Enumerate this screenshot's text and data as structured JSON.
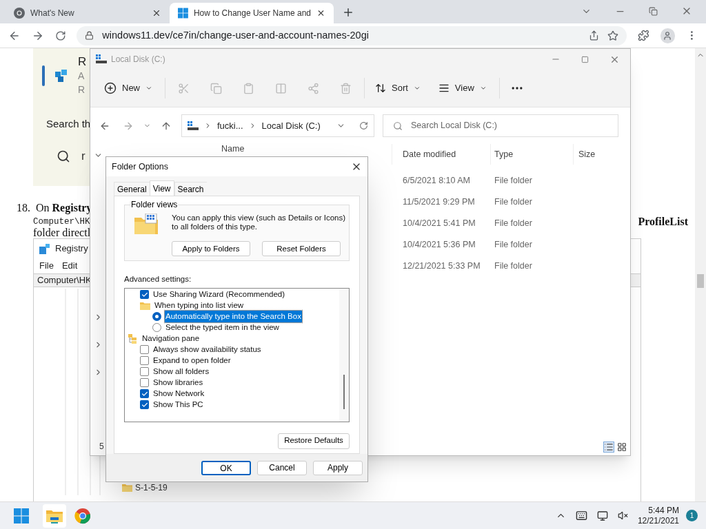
{
  "browser": {
    "tabs": [
      {
        "title": "What's New",
        "selected": false
      },
      {
        "title": "How to Change User Name and",
        "selected": true
      }
    ],
    "url": "windows11.dev/ce7in/change-user-and-account-names-20gi"
  },
  "article": {
    "card_lines": [
      "R",
      "A",
      "R"
    ],
    "search_heading": "Search th",
    "search_text": "r",
    "step_number": "18.",
    "step_text": "On **Registry**",
    "code": "Computer\\HK",
    "right_text": "ProfileList",
    "text_line": "folder directl",
    "registry": {
      "title": "Registry",
      "menu": [
        "File",
        "Edit"
      ],
      "address": "Computer\\HK",
      "keys": [
        "S-1-5-19"
      ]
    }
  },
  "explorer": {
    "title": "Local Disk (C:)",
    "new_label": "New",
    "sort_label": "Sort",
    "view_label": "View",
    "breadcrumb": [
      "fucki...",
      "Local Disk (C:)"
    ],
    "search_placeholder": "Search Local Disk (C:)",
    "columns": [
      "Name",
      "Date modified",
      "Type",
      "Size"
    ],
    "rows": [
      {
        "date": "6/5/2021 8:10 AM",
        "type": "File folder"
      },
      {
        "date": "11/5/2021 9:29 PM",
        "type": "File folder"
      },
      {
        "date": "10/4/2021 5:41 PM",
        "type": "File folder"
      },
      {
        "date": "10/4/2021 5:36 PM",
        "type": "File folder"
      },
      {
        "date": "12/21/2021 5:33 PM",
        "type": "File folder"
      }
    ],
    "status": "5"
  },
  "dialog": {
    "title": "Folder Options",
    "tabs": [
      {
        "label": "General",
        "selected": false
      },
      {
        "label": "View",
        "selected": true
      },
      {
        "label": "Search",
        "selected": false
      }
    ],
    "folder_views": {
      "legend": "Folder views",
      "text": "You can apply this view (such as Details or Icons) to all folders of this type.",
      "buttons": [
        "Apply to Folders",
        "Reset Folders"
      ]
    },
    "advanced_label": "Advanced settings:",
    "settings": [
      {
        "kind": "checkbox",
        "label": "Use Sharing Wizard (Recommended)",
        "checked": true
      },
      {
        "kind": "folder",
        "label": "When typing into list view",
        "children": [
          {
            "kind": "radio",
            "label": "Automatically type into the Search Box",
            "checked": true,
            "selected": true
          },
          {
            "kind": "radio",
            "label": "Select the typed item in the view",
            "checked": false,
            "selected": false
          }
        ]
      },
      {
        "kind": "group",
        "label": "Navigation pane",
        "children": [
          {
            "kind": "checkbox",
            "label": "Always show availability status",
            "checked": false
          },
          {
            "kind": "checkbox",
            "label": "Expand to open folder",
            "checked": false
          },
          {
            "kind": "checkbox",
            "label": "Show all folders",
            "checked": false
          },
          {
            "kind": "checkbox",
            "label": "Show libraries",
            "checked": false
          },
          {
            "kind": "checkbox",
            "label": "Show Network",
            "checked": true
          },
          {
            "kind": "checkbox",
            "label": "Show This PC",
            "checked": true
          }
        ]
      }
    ],
    "restore_label": "Restore Defaults",
    "buttons": [
      {
        "label": "OK",
        "default": true
      },
      {
        "label": "Cancel",
        "default": false
      },
      {
        "label": "Apply",
        "default": false
      }
    ]
  },
  "taskbar": {
    "time": "5:44 PM",
    "date": "12/21/2021",
    "badge": "1"
  }
}
